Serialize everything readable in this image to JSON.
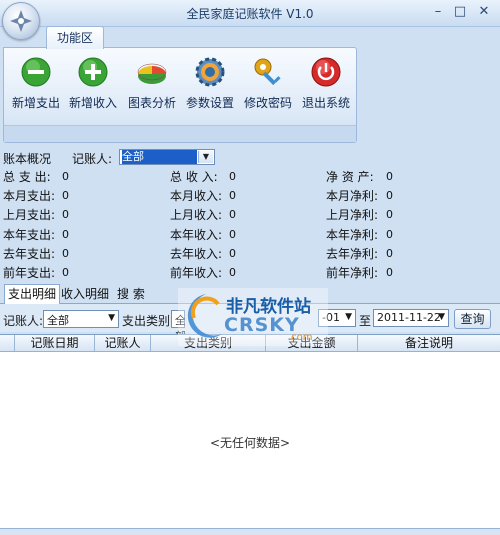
{
  "window": {
    "title": "全民家庭记账软件 V1.0"
  },
  "ribbon": {
    "tab": "功能区",
    "buttons": [
      {
        "label": "新增支出",
        "icon": "minus-icon",
        "color": "#3aa536"
      },
      {
        "label": "新增收入",
        "icon": "plus-icon",
        "color": "#3aa536"
      },
      {
        "label": "图表分析",
        "icon": "pie-chart-icon",
        "color": "#e04a2f"
      },
      {
        "label": "参数设置",
        "icon": "gear-icon",
        "color": "#2f6ea8"
      },
      {
        "label": "修改密码",
        "icon": "key-icon",
        "color": "#e2a417"
      },
      {
        "label": "退出系统",
        "icon": "power-icon",
        "color": "#d62a2a"
      }
    ]
  },
  "overview": {
    "title": "账本概况",
    "bookkeeper_label": "记账人:",
    "bookkeeper_value": "全部",
    "rows": [
      [
        {
          "label": "总 支 出:",
          "value": "0"
        },
        {
          "label": "总 收 入:",
          "value": "0"
        },
        {
          "label": "净 资 产:",
          "value": "0"
        }
      ],
      [
        {
          "label": "本月支出:",
          "value": "0"
        },
        {
          "label": "本月收入:",
          "value": "0"
        },
        {
          "label": "本月净利:",
          "value": "0"
        }
      ],
      [
        {
          "label": "上月支出:",
          "value": "0"
        },
        {
          "label": "上月收入:",
          "value": "0"
        },
        {
          "label": "上月净利:",
          "value": "0"
        }
      ],
      [
        {
          "label": "本年支出:",
          "value": "0"
        },
        {
          "label": "本年收入:",
          "value": "0"
        },
        {
          "label": "本年净利:",
          "value": "0"
        }
      ],
      [
        {
          "label": "去年支出:",
          "value": "0"
        },
        {
          "label": "去年收入:",
          "value": "0"
        },
        {
          "label": "去年净利:",
          "value": "0"
        }
      ],
      [
        {
          "label": "前年支出:",
          "value": "0"
        },
        {
          "label": "前年收入:",
          "value": "0"
        },
        {
          "label": "前年净利:",
          "value": "0"
        }
      ]
    ]
  },
  "tabs": [
    "支出明细",
    "收入明细",
    "搜 索"
  ],
  "filters": {
    "bookkeeper_label": "记账人:",
    "bookkeeper_value": "全部",
    "category_label": "支出类别:",
    "category_value": "全部",
    "date_from": "-01",
    "to_label": "至",
    "date_to": "2011-11-22",
    "query_button": "查询"
  },
  "grid": {
    "columns": [
      "记账日期",
      "记账人",
      "支出类别",
      "支出金额",
      "备注说明"
    ],
    "empty_text": "<无任何数据>"
  },
  "watermark": {
    "brand": "非凡软件站",
    "sub": "CRSKY",
    "domain": ".com"
  }
}
